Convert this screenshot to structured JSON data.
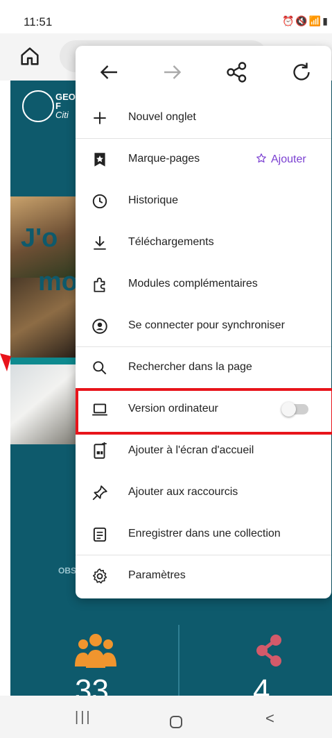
{
  "status_bar": {
    "time": "11:51",
    "icons": [
      "alarm-icon",
      "alarm-icon",
      "mute-icon",
      "4g-icon",
      "signal-icon",
      "battery-icon"
    ]
  },
  "toolbar": {
    "home_icon": "home-icon"
  },
  "background_page": {
    "site_title_line1": "GEO",
    "site_title_line2": "F",
    "site_title_line3": "Citi",
    "big_text_line1": "J'o",
    "big_text_line2": "mo",
    "obs_label": "OBS",
    "stat_left": "33",
    "stat_right": "4",
    "colors": {
      "page_bg": "#0e5a6c",
      "people_icon": "#f0952e",
      "share_icon": "#d35a6a"
    }
  },
  "menu": {
    "top_nav": [
      "back-arrow-icon",
      "forward-arrow-icon",
      "share-icon",
      "reload-icon"
    ],
    "items": [
      {
        "label": "Nouvel onglet",
        "icon": "plus-icon"
      },
      {
        "label": "Marque-pages",
        "icon": "bookmark-star-icon",
        "action_label": "Ajouter"
      },
      {
        "label": "Historique",
        "icon": "clock-icon"
      },
      {
        "label": "Téléchargements",
        "icon": "download-icon"
      },
      {
        "label": "Modules complémentaires",
        "icon": "puzzle-icon"
      },
      {
        "label": "Se connecter pour synchroniser",
        "icon": "account-icon"
      },
      {
        "label": "Rechercher dans la page",
        "icon": "search-icon"
      },
      {
        "label": "Version ordinateur",
        "icon": "laptop-icon",
        "toggle_on": false
      },
      {
        "label": "Ajouter à l'écran d'accueil",
        "icon": "add-to-home-icon"
      },
      {
        "label": "Ajouter aux raccourcis",
        "icon": "pin-icon"
      },
      {
        "label": "Enregistrer dans une collection",
        "icon": "collection-icon"
      },
      {
        "label": "Paramètres",
        "icon": "gear-icon"
      }
    ],
    "accent_color": "#7a3fd1",
    "highlight_color": "#e8141b"
  },
  "nav_bar": {
    "recents": "|||",
    "back": "<"
  }
}
